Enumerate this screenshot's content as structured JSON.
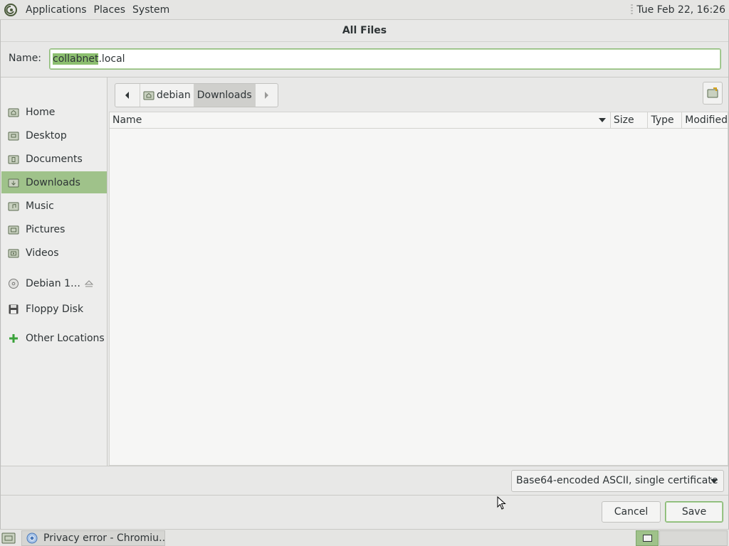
{
  "top_panel": {
    "menus": [
      "Applications",
      "Places",
      "System"
    ],
    "clock": "Tue Feb 22, 16:26"
  },
  "dialog": {
    "title": "All Files",
    "name_label": "Name:",
    "name_value_selected": "collabnet",
    "name_value_rest": ".local",
    "places": [
      {
        "label": "Home",
        "icon": "home-folder-icon"
      },
      {
        "label": "Desktop",
        "icon": "desktop-folder-icon"
      },
      {
        "label": "Documents",
        "icon": "documents-folder-icon"
      },
      {
        "label": "Downloads",
        "icon": "downloads-folder-icon",
        "active": true
      },
      {
        "label": "Music",
        "icon": "music-folder-icon"
      },
      {
        "label": "Pictures",
        "icon": "pictures-folder-icon"
      },
      {
        "label": "Videos",
        "icon": "videos-folder-icon"
      },
      {
        "label": "Debian 1…",
        "icon": "disc-icon"
      },
      {
        "label": "Floppy Disk",
        "icon": "floppy-icon"
      },
      {
        "label": "Other Locations",
        "icon": "plus-icon"
      }
    ],
    "path": [
      "debian",
      "Downloads"
    ],
    "columns": [
      "Name",
      "Size",
      "Type",
      "Modified"
    ],
    "filter": "Base64-encoded ASCII, single certificate",
    "cancel_label": "Cancel",
    "save_label": "Save"
  },
  "taskbar": {
    "task_label": "Privacy error - Chromiu…"
  },
  "colors": {
    "accent": "#9fc28a",
    "selection": "#8cbf6f",
    "panel": "#e5e5e3"
  }
}
